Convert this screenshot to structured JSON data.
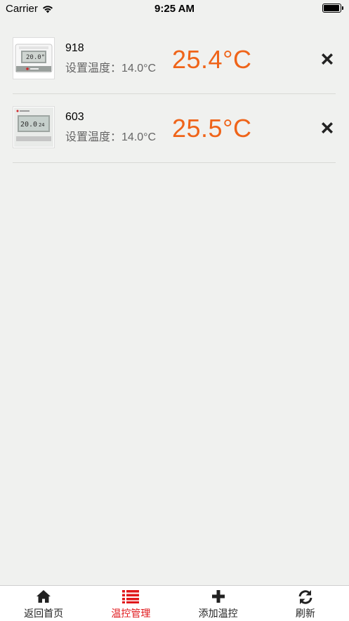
{
  "status_bar": {
    "carrier": "Carrier",
    "time": "9:25 AM"
  },
  "thermostats": [
    {
      "name": "918",
      "set_label": "设置温度：",
      "set_value": "14.0°C",
      "current_temp": "25.4°C"
    },
    {
      "name": "603",
      "set_label": "设置温度：",
      "set_value": "14.0°C",
      "current_temp": "25.5°C"
    }
  ],
  "tabs": [
    {
      "label": "返回首页",
      "icon": "home-icon",
      "active": false
    },
    {
      "label": "温控管理",
      "icon": "list-icon",
      "active": true
    },
    {
      "label": "添加温控",
      "icon": "plus-icon",
      "active": false
    },
    {
      "label": "刷新",
      "icon": "refresh-icon",
      "active": false
    }
  ],
  "colors": {
    "background": "#f0f1ef",
    "temperature": "#ef6419",
    "active_tab": "#e0171b",
    "tab_bar": "#ffffff"
  }
}
